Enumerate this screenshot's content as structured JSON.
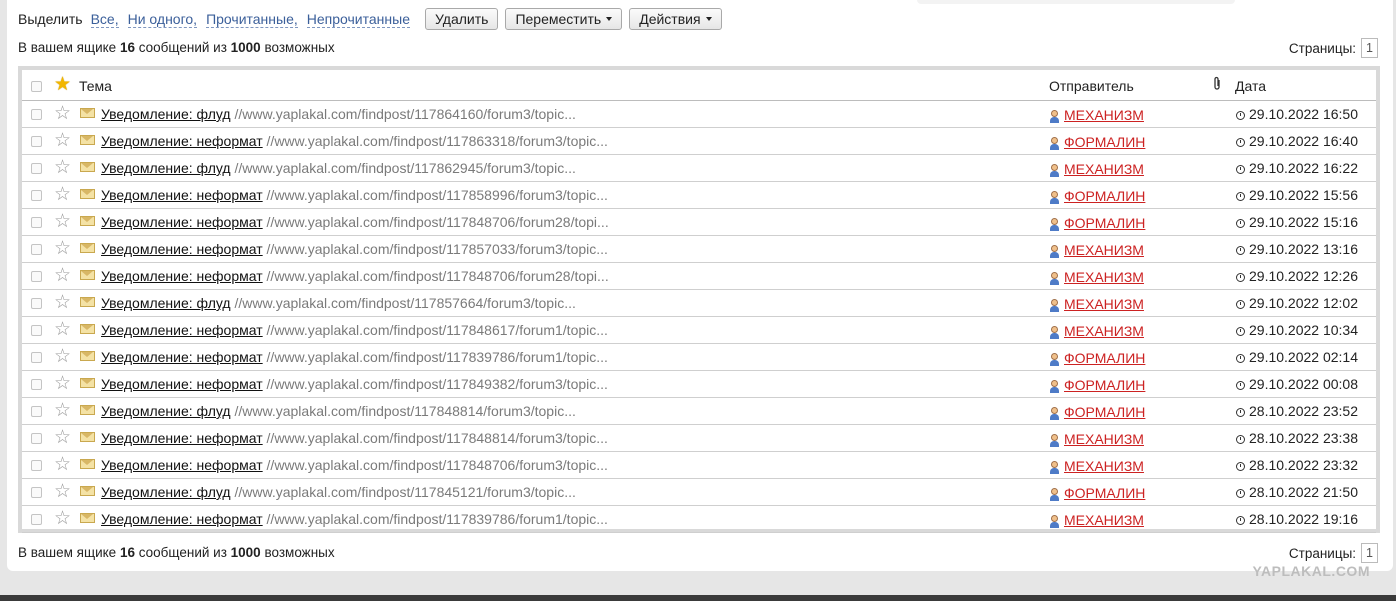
{
  "toolbar": {
    "select_label": "Выделить",
    "select_links": [
      "Все,",
      "Ни одного,",
      "Прочитанные,",
      "Непрочитанные"
    ],
    "delete_label": "Удалить",
    "move_label": "Переместить",
    "actions_label": "Действия"
  },
  "summary": {
    "prefix": "В вашем ящике",
    "count": "16",
    "middle": "сообщений из",
    "max": "1000",
    "suffix": "возможных",
    "pages_label": "Страницы:",
    "page_number": "1"
  },
  "table": {
    "col_theme": "Тема",
    "col_sender": "Отправитель",
    "col_attachment_icon": "paperclip-icon",
    "col_date": "Дата",
    "rows": [
      {
        "subject": "Уведомление: флуд",
        "snippet": " //www.yaplakal.com/findpost/117864160/forum3/topic...",
        "sender": "МЕХАНИЗМ",
        "date": "29.10.2022 16:50"
      },
      {
        "subject": "Уведомление: неформат",
        "snippet": " //www.yaplakal.com/findpost/117863318/forum3/topic...",
        "sender": "ФОРМАЛИН",
        "date": "29.10.2022 16:40"
      },
      {
        "subject": "Уведомление: флуд",
        "snippet": " //www.yaplakal.com/findpost/117862945/forum3/topic...",
        "sender": "МЕХАНИЗМ",
        "date": "29.10.2022 16:22"
      },
      {
        "subject": "Уведомление: неформат",
        "snippet": " //www.yaplakal.com/findpost/117858996/forum3/topic...",
        "sender": "ФОРМАЛИН",
        "date": "29.10.2022 15:56"
      },
      {
        "subject": "Уведомление: неформат",
        "snippet": " //www.yaplakal.com/findpost/117848706/forum28/topi...",
        "sender": "ФОРМАЛИН",
        "date": "29.10.2022 15:16"
      },
      {
        "subject": "Уведомление: неформат",
        "snippet": " //www.yaplakal.com/findpost/117857033/forum3/topic...",
        "sender": "МЕХАНИЗМ",
        "date": "29.10.2022 13:16"
      },
      {
        "subject": "Уведомление: неформат",
        "snippet": " //www.yaplakal.com/findpost/117848706/forum28/topi...",
        "sender": "МЕХАНИЗМ",
        "date": "29.10.2022 12:26"
      },
      {
        "subject": "Уведомление: флуд",
        "snippet": " //www.yaplakal.com/findpost/117857664/forum3/topic...",
        "sender": "МЕХАНИЗМ",
        "date": "29.10.2022 12:02"
      },
      {
        "subject": "Уведомление: неформат",
        "snippet": " //www.yaplakal.com/findpost/117848617/forum1/topic...",
        "sender": "МЕХАНИЗМ",
        "date": "29.10.2022 10:34"
      },
      {
        "subject": "Уведомление: неформат",
        "snippet": " //www.yaplakal.com/findpost/117839786/forum1/topic...",
        "sender": "ФОРМАЛИН",
        "date": "29.10.2022 02:14"
      },
      {
        "subject": "Уведомление: неформат",
        "snippet": " //www.yaplakal.com/findpost/117849382/forum3/topic...",
        "sender": "ФОРМАЛИН",
        "date": "29.10.2022 00:08"
      },
      {
        "subject": "Уведомление: флуд",
        "snippet": " //www.yaplakal.com/findpost/117848814/forum3/topic...",
        "sender": "ФОРМАЛИН",
        "date": "28.10.2022 23:52"
      },
      {
        "subject": "Уведомление: неформат",
        "snippet": " //www.yaplakal.com/findpost/117848814/forum3/topic...",
        "sender": "МЕХАНИЗМ",
        "date": "28.10.2022 23:38"
      },
      {
        "subject": "Уведомление: неформат",
        "snippet": " //www.yaplakal.com/findpost/117848706/forum3/topic...",
        "sender": "МЕХАНИЗМ",
        "date": "28.10.2022 23:32"
      },
      {
        "subject": "Уведомление: флуд",
        "snippet": " //www.yaplakal.com/findpost/117845121/forum3/topic...",
        "sender": "ФОРМАЛИН",
        "date": "28.10.2022 21:50"
      },
      {
        "subject": "Уведомление: неформат",
        "snippet": " //www.yaplakal.com/findpost/117839786/forum1/topic...",
        "sender": "МЕХАНИЗМ",
        "date": "28.10.2022 19:16"
      }
    ]
  },
  "watermark": "YAPLAKAL.COM",
  "colors": {
    "sender_link": "#cc2222",
    "select_link": "#3b5f9a",
    "star_active": "#f2b600"
  }
}
